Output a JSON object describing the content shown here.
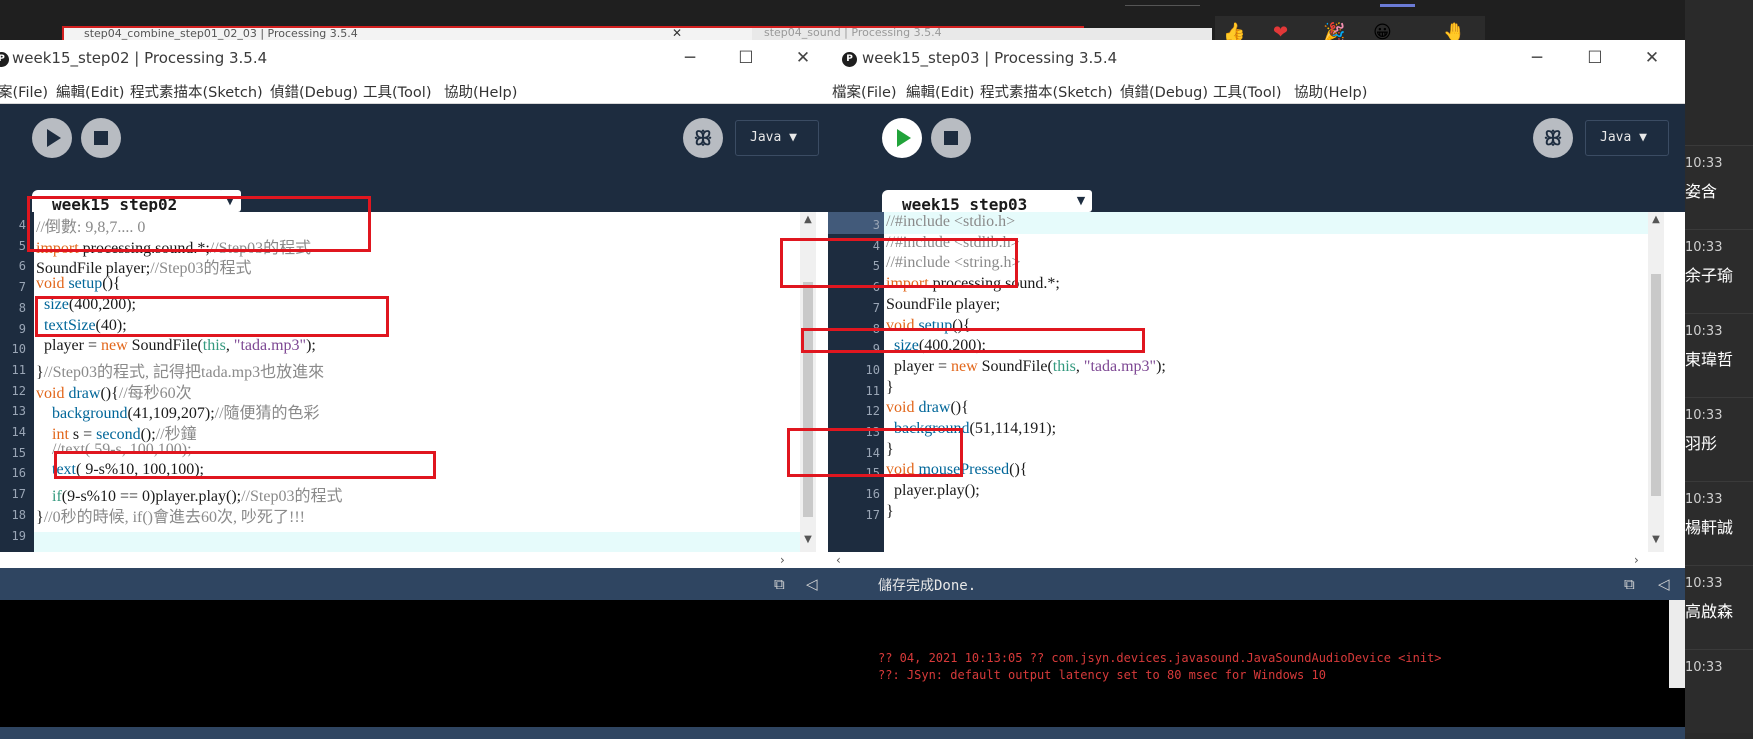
{
  "background": {
    "tab_left_title": "step04_combine_step01_02_03 | Processing 3.5.4",
    "tab_right_title": "step04_sound | Processing 3.5.4",
    "emojis": [
      "👍",
      "❤",
      "🎉",
      "😀",
      "🤚"
    ]
  },
  "chat": {
    "items": [
      {
        "time": "10:33",
        "name": "姿含"
      },
      {
        "time": "10:33",
        "name": "余子瑜"
      },
      {
        "time": "10:33",
        "name": "東瑋哲"
      },
      {
        "time": "10:33",
        "name": "羽彤"
      },
      {
        "time": "10:33",
        "name": "楊軒誠"
      },
      {
        "time": "10:33",
        "name": "高啟森"
      },
      {
        "time": "10:33",
        "name": ""
      }
    ]
  },
  "left_window": {
    "title": "week15_step02 | Processing 3.5.4",
    "logo": "P",
    "menu": [
      "案(File)",
      "編輯(Edit)",
      "程式素描本(Sketch)",
      "偵錯(Debug)",
      "工具(Tool)",
      "協助(Help)"
    ],
    "mode": "Java ▼",
    "tab": "week15_step02",
    "lines": [
      {
        "n": "4",
        "parts": [
          [
            "c-cm",
            "//倒數: 9,8,7.... 0"
          ]
        ]
      },
      {
        "n": "5",
        "parts": [
          [
            "c-kw",
            "import"
          ],
          [
            "",
            " processing.sound.*;"
          ],
          [
            "c-cm",
            "//Step03的程式"
          ]
        ]
      },
      {
        "n": "6",
        "parts": [
          [
            "",
            "SoundFile player;"
          ],
          [
            "c-cm",
            "//Step03的程式"
          ]
        ]
      },
      {
        "n": "7",
        "parts": [
          [
            "c-kw",
            "void"
          ],
          [
            "",
            " "
          ],
          [
            "c-fn",
            "setup"
          ],
          [
            "",
            "(){"
          ]
        ]
      },
      {
        "n": "8",
        "parts": [
          [
            "",
            "  "
          ],
          [
            "c-fn",
            "size"
          ],
          [
            "",
            "(400,200);"
          ]
        ]
      },
      {
        "n": "9",
        "parts": [
          [
            "",
            "  "
          ],
          [
            "c-fn",
            "textSize"
          ],
          [
            "",
            "(40);"
          ]
        ]
      },
      {
        "n": "10",
        "parts": [
          [
            "",
            "  player = "
          ],
          [
            "c-kw",
            "new"
          ],
          [
            "",
            " SoundFile("
          ],
          [
            "c-grn",
            "this"
          ],
          [
            "",
            ", "
          ],
          [
            "c-str",
            "\"tada.mp3\""
          ],
          [
            "",
            ");"
          ]
        ]
      },
      {
        "n": "11",
        "parts": [
          [
            "",
            "}"
          ],
          [
            "c-cm",
            "//Step03的程式, 記得把tada.mp3也放進來"
          ]
        ]
      },
      {
        "n": "12",
        "parts": [
          [
            "c-kw",
            "void"
          ],
          [
            "",
            " "
          ],
          [
            "c-fn",
            "draw"
          ],
          [
            "",
            "(){"
          ],
          [
            "c-cm",
            "//每秒60次"
          ]
        ]
      },
      {
        "n": "13",
        "parts": [
          [
            "",
            "    "
          ],
          [
            "c-fn",
            "background"
          ],
          [
            "",
            "(41,109,207);"
          ],
          [
            "c-cm",
            "//隨便猜的色彩"
          ]
        ]
      },
      {
        "n": "14",
        "parts": [
          [
            "",
            "    "
          ],
          [
            "c-kw",
            "int"
          ],
          [
            "",
            " s = "
          ],
          [
            "c-fn",
            "second"
          ],
          [
            "",
            "();"
          ],
          [
            "c-cm",
            "//秒鐘"
          ]
        ]
      },
      {
        "n": "15",
        "parts": [
          [
            "",
            "    "
          ],
          [
            "c-cm",
            "//text( 59-s, 100,100);"
          ]
        ]
      },
      {
        "n": "16",
        "parts": [
          [
            "",
            "    "
          ],
          [
            "c-fn",
            "text"
          ],
          [
            "",
            "( 9-s%10, 100,100);"
          ]
        ]
      },
      {
        "n": "17",
        "parts": [
          [
            "",
            "    "
          ],
          [
            "c-grn",
            "if"
          ],
          [
            "",
            "(9-s%10 == 0)player.play();"
          ],
          [
            "c-cm",
            "//Step03的程式"
          ]
        ]
      },
      {
        "n": "18",
        "parts": [
          [
            "",
            "}"
          ],
          [
            "c-cm",
            "//0秒的時候, if()會進去60次, 吵死了!!!"
          ]
        ]
      },
      {
        "n": "19",
        "parts": [
          [
            "",
            ""
          ]
        ]
      }
    ],
    "status": "",
    "console": []
  },
  "right_window": {
    "title": "week15_step03 | Processing 3.5.4",
    "logo": "P",
    "menu": [
      "檔案(File)",
      "編輯(Edit)",
      "程式素描本(Sketch)",
      "偵錯(Debug)",
      "工具(Tool)",
      "協助(Help)"
    ],
    "mode": "Java ▼",
    "tab": "week15_step03",
    "lines": [
      {
        "n": "3",
        "parts": [
          [
            "c-cm",
            "//#include <stdio.h>"
          ]
        ]
      },
      {
        "n": "4",
        "parts": [
          [
            "c-cm",
            "//#include <stdlib.h>"
          ]
        ]
      },
      {
        "n": "5",
        "parts": [
          [
            "c-cm",
            "//#include <string.h>"
          ]
        ]
      },
      {
        "n": "6",
        "parts": [
          [
            "c-kw",
            "import"
          ],
          [
            "",
            " processing.sound.*;"
          ]
        ]
      },
      {
        "n": "7",
        "parts": [
          [
            "",
            "SoundFile player;"
          ]
        ]
      },
      {
        "n": "8",
        "parts": [
          [
            "c-kw",
            "void"
          ],
          [
            "",
            " "
          ],
          [
            "c-fn",
            "setup"
          ],
          [
            "",
            "(){"
          ]
        ]
      },
      {
        "n": "9",
        "parts": [
          [
            "",
            "  "
          ],
          [
            "c-fn",
            "size"
          ],
          [
            "",
            "(400,200);"
          ]
        ]
      },
      {
        "n": "10",
        "parts": [
          [
            "",
            "  player = "
          ],
          [
            "c-kw",
            "new"
          ],
          [
            "",
            " SoundFile("
          ],
          [
            "c-grn",
            "this"
          ],
          [
            "",
            ", "
          ],
          [
            "c-str",
            "\"tada.mp3\""
          ],
          [
            "",
            ");"
          ]
        ]
      },
      {
        "n": "11",
        "parts": [
          [
            "",
            "}"
          ]
        ]
      },
      {
        "n": "12",
        "parts": [
          [
            "c-kw",
            "void"
          ],
          [
            "",
            " "
          ],
          [
            "c-fn",
            "draw"
          ],
          [
            "",
            "(){"
          ]
        ]
      },
      {
        "n": "13",
        "parts": [
          [
            "",
            "  "
          ],
          [
            "c-fn",
            "background"
          ],
          [
            "",
            "(51,114,191);"
          ]
        ]
      },
      {
        "n": "14",
        "parts": [
          [
            "",
            "}"
          ]
        ]
      },
      {
        "n": "15",
        "parts": [
          [
            "c-kw",
            "void"
          ],
          [
            "",
            " "
          ],
          [
            "c-fn",
            "mousePressed"
          ],
          [
            "",
            "(){"
          ]
        ]
      },
      {
        "n": "16",
        "parts": [
          [
            "",
            "  player.play();"
          ]
        ]
      },
      {
        "n": "17",
        "parts": [
          [
            "",
            "}"
          ]
        ]
      }
    ],
    "status": "儲存完成Done.",
    "console": [
      "?? 04, 2021 10:13:05 ?? com.jsyn.devices.javasound.JavaSoundAudioDevice <init>",
      "??: JSyn: default output latency set to 80 msec for Windows 10"
    ]
  },
  "colors": {
    "toolbar": "#1d2c3f",
    "status": "#2f4561",
    "highlight_box": "#e0161f",
    "keyword": "#e2661a",
    "function": "#006699",
    "string": "#7d4793",
    "comment": "#8a8a8a",
    "run_active": "#21a33a"
  }
}
